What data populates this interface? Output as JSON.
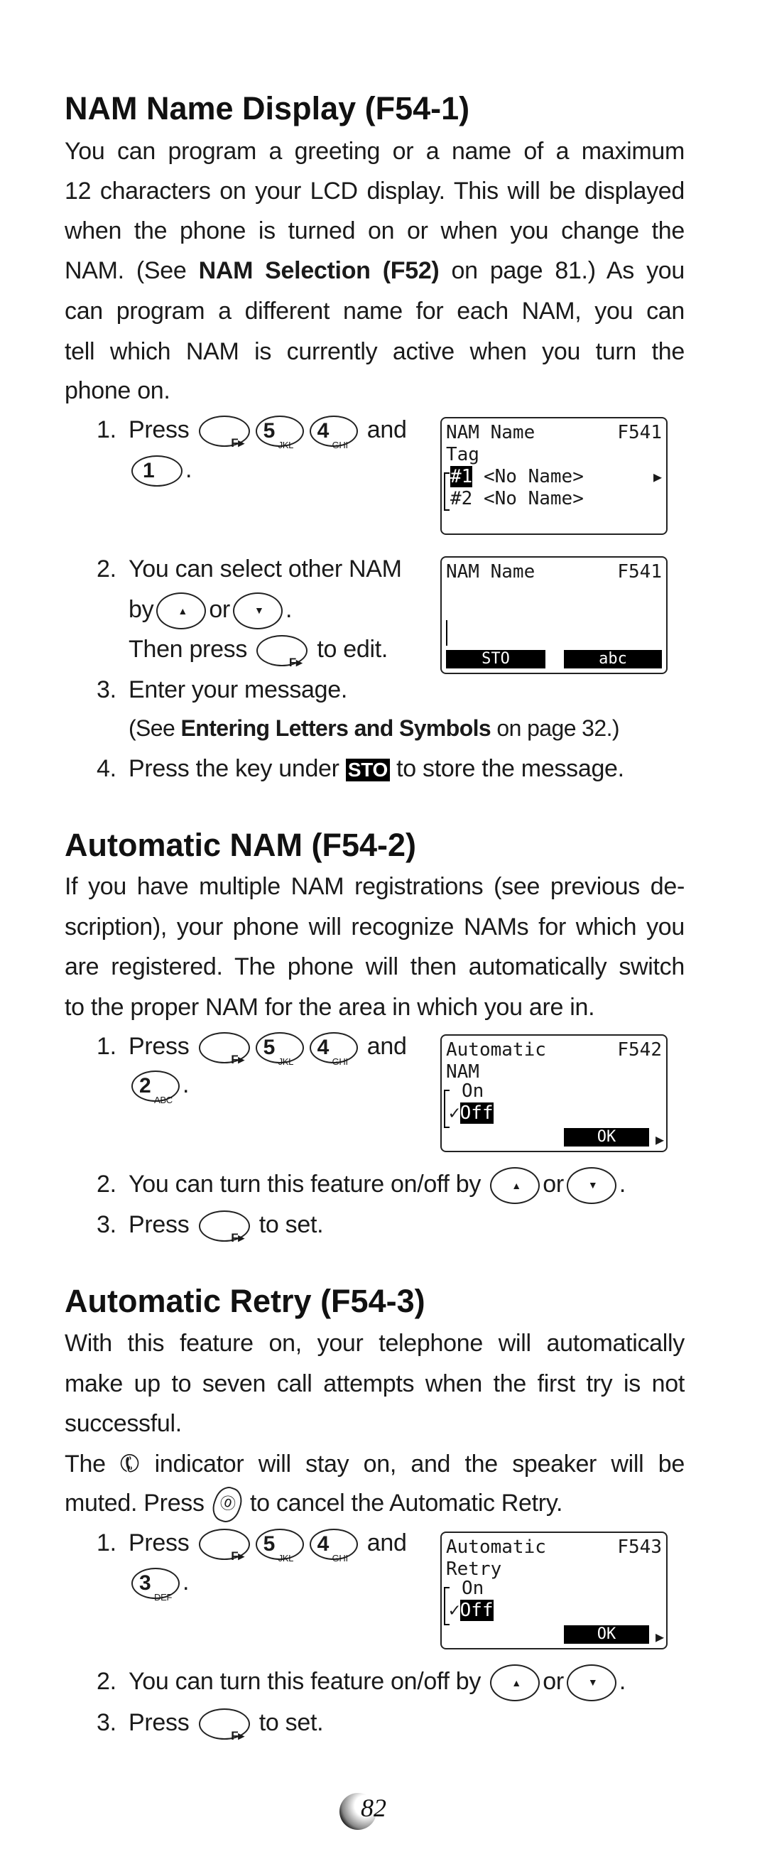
{
  "s1": {
    "title": "NAM Name Display (F54-1)",
    "para": [
      "You can program a greeting or a name of a maximum",
      "12 characters on your LCD display. This will be displayed",
      "when the phone is turned on or when you change the",
      [
        "NAM. (See ",
        "NAM Selection (F52)",
        " on page 81.) As you"
      ],
      "can program a different name for each NAM, you can",
      "tell which NAM is currently active when you turn the",
      "phone on."
    ],
    "step1": {
      "num": "1.",
      "press": "Press",
      "and": "and",
      "end": "."
    },
    "step2": {
      "num": "2.",
      "text": "You can select other NAM",
      "by": "by",
      "or": "or",
      "end": ".",
      "then": "Then press",
      "edit": "to edit."
    },
    "step3": {
      "num": "3.",
      "text": "Enter your message."
    },
    "see": {
      "pre": "(See ",
      "bold": "Entering Letters and Symbols",
      "post": " on page 32.)"
    },
    "step4": {
      "num": "4.",
      "pre": "Press the key under",
      "sto": "STO",
      "post": "to store the message."
    },
    "lcd1": {
      "title": "NAM Name",
      "code": "F541",
      "l2": "Tag",
      "i1": "#1",
      "n1": " <No Name>",
      "i2": "#2",
      "n2": " <No Name>",
      "arrow": "▶"
    },
    "lcd2": {
      "title": "NAM Name",
      "code": "F541",
      "soft1": "STO",
      "soft2": "abc"
    }
  },
  "s2": {
    "title": "Automatic NAM (F54-2)",
    "para": [
      "If you have multiple NAM registrations (see previous de-",
      "scription), your phone will recognize NAMs for which you",
      "are registered. The phone will then automatically switch",
      "to the proper NAM for the area in which you are in."
    ],
    "step1": {
      "num": "1.",
      "press": "Press",
      "and": "and",
      "end": "."
    },
    "step2": {
      "num": "2.",
      "text": "You can turn this feature on/off by",
      "or": "or",
      "end": "."
    },
    "step3": {
      "num": "3.",
      "press": "Press",
      "post": "to set."
    },
    "lcd": {
      "title": "Automatic",
      "code": "F542",
      "l2": "NAM",
      "on": "On",
      "check": "✓",
      "off": "Off",
      "ok": "OK"
    }
  },
  "s3": {
    "title": "Automatic Retry (F54-3)",
    "para": [
      "With this feature on, your telephone will automatically",
      "make up to seven call attempts when the first try is not",
      "successful."
    ],
    "ind": {
      "pre": "The",
      "post": "indicator will stay on, and the speaker will be"
    },
    "muted": {
      "pre": "muted. Press",
      "post": "to cancel the Automatic Retry."
    },
    "step1": {
      "num": "1.",
      "press": "Press",
      "and": "and",
      "end": "."
    },
    "step2": {
      "num": "2.",
      "text": "You can turn this feature on/off by",
      "or": "or",
      "end": "."
    },
    "step3": {
      "num": "3.",
      "press": "Press",
      "post": "to set."
    },
    "lcd": {
      "title": "Automatic",
      "code": "F543",
      "l2": "Retry",
      "on": "On",
      "check": "✓",
      "off": "Off",
      "ok": "OK"
    }
  },
  "keys": {
    "f": "F▸",
    "k1": "1",
    "k2": "2",
    "k2l": "ABC",
    "k3": "3",
    "k3l": "DEF",
    "k4": "4",
    "k4l": "GHI",
    "k5": "5",
    "k5l": "JKL",
    "up": "▲",
    "down": "▼",
    "end": "⓪"
  },
  "page_number": "82"
}
